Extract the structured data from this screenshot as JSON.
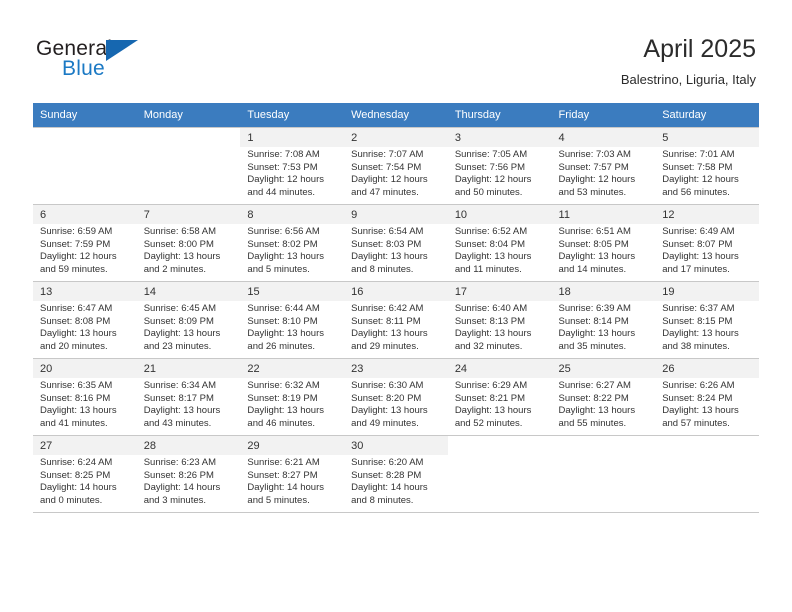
{
  "logo": {
    "word1": "General",
    "word2": "Blue",
    "triangle_color": "#1667b0"
  },
  "header": {
    "title": "April 2025",
    "subtitle": "Balestrino, Liguria, Italy"
  },
  "theme": {
    "header_bg": "#3b7cbf",
    "daynum_band": "#f2f2f2",
    "grid_line": "#c8c8c8"
  },
  "weekdays": [
    "Sunday",
    "Monday",
    "Tuesday",
    "Wednesday",
    "Thursday",
    "Friday",
    "Saturday"
  ],
  "weeks": [
    [
      {
        "day": "",
        "sunrise": "",
        "sunset": "",
        "daylight1": "",
        "daylight2": ""
      },
      {
        "day": "",
        "sunrise": "",
        "sunset": "",
        "daylight1": "",
        "daylight2": ""
      },
      {
        "day": "1",
        "sunrise": "Sunrise: 7:08 AM",
        "sunset": "Sunset: 7:53 PM",
        "daylight1": "Daylight: 12 hours",
        "daylight2": "and 44 minutes."
      },
      {
        "day": "2",
        "sunrise": "Sunrise: 7:07 AM",
        "sunset": "Sunset: 7:54 PM",
        "daylight1": "Daylight: 12 hours",
        "daylight2": "and 47 minutes."
      },
      {
        "day": "3",
        "sunrise": "Sunrise: 7:05 AM",
        "sunset": "Sunset: 7:56 PM",
        "daylight1": "Daylight: 12 hours",
        "daylight2": "and 50 minutes."
      },
      {
        "day": "4",
        "sunrise": "Sunrise: 7:03 AM",
        "sunset": "Sunset: 7:57 PM",
        "daylight1": "Daylight: 12 hours",
        "daylight2": "and 53 minutes."
      },
      {
        "day": "5",
        "sunrise": "Sunrise: 7:01 AM",
        "sunset": "Sunset: 7:58 PM",
        "daylight1": "Daylight: 12 hours",
        "daylight2": "and 56 minutes."
      }
    ],
    [
      {
        "day": "6",
        "sunrise": "Sunrise: 6:59 AM",
        "sunset": "Sunset: 7:59 PM",
        "daylight1": "Daylight: 12 hours",
        "daylight2": "and 59 minutes."
      },
      {
        "day": "7",
        "sunrise": "Sunrise: 6:58 AM",
        "sunset": "Sunset: 8:00 PM",
        "daylight1": "Daylight: 13 hours",
        "daylight2": "and 2 minutes."
      },
      {
        "day": "8",
        "sunrise": "Sunrise: 6:56 AM",
        "sunset": "Sunset: 8:02 PM",
        "daylight1": "Daylight: 13 hours",
        "daylight2": "and 5 minutes."
      },
      {
        "day": "9",
        "sunrise": "Sunrise: 6:54 AM",
        "sunset": "Sunset: 8:03 PM",
        "daylight1": "Daylight: 13 hours",
        "daylight2": "and 8 minutes."
      },
      {
        "day": "10",
        "sunrise": "Sunrise: 6:52 AM",
        "sunset": "Sunset: 8:04 PM",
        "daylight1": "Daylight: 13 hours",
        "daylight2": "and 11 minutes."
      },
      {
        "day": "11",
        "sunrise": "Sunrise: 6:51 AM",
        "sunset": "Sunset: 8:05 PM",
        "daylight1": "Daylight: 13 hours",
        "daylight2": "and 14 minutes."
      },
      {
        "day": "12",
        "sunrise": "Sunrise: 6:49 AM",
        "sunset": "Sunset: 8:07 PM",
        "daylight1": "Daylight: 13 hours",
        "daylight2": "and 17 minutes."
      }
    ],
    [
      {
        "day": "13",
        "sunrise": "Sunrise: 6:47 AM",
        "sunset": "Sunset: 8:08 PM",
        "daylight1": "Daylight: 13 hours",
        "daylight2": "and 20 minutes."
      },
      {
        "day": "14",
        "sunrise": "Sunrise: 6:45 AM",
        "sunset": "Sunset: 8:09 PM",
        "daylight1": "Daylight: 13 hours",
        "daylight2": "and 23 minutes."
      },
      {
        "day": "15",
        "sunrise": "Sunrise: 6:44 AM",
        "sunset": "Sunset: 8:10 PM",
        "daylight1": "Daylight: 13 hours",
        "daylight2": "and 26 minutes."
      },
      {
        "day": "16",
        "sunrise": "Sunrise: 6:42 AM",
        "sunset": "Sunset: 8:11 PM",
        "daylight1": "Daylight: 13 hours",
        "daylight2": "and 29 minutes."
      },
      {
        "day": "17",
        "sunrise": "Sunrise: 6:40 AM",
        "sunset": "Sunset: 8:13 PM",
        "daylight1": "Daylight: 13 hours",
        "daylight2": "and 32 minutes."
      },
      {
        "day": "18",
        "sunrise": "Sunrise: 6:39 AM",
        "sunset": "Sunset: 8:14 PM",
        "daylight1": "Daylight: 13 hours",
        "daylight2": "and 35 minutes."
      },
      {
        "day": "19",
        "sunrise": "Sunrise: 6:37 AM",
        "sunset": "Sunset: 8:15 PM",
        "daylight1": "Daylight: 13 hours",
        "daylight2": "and 38 minutes."
      }
    ],
    [
      {
        "day": "20",
        "sunrise": "Sunrise: 6:35 AM",
        "sunset": "Sunset: 8:16 PM",
        "daylight1": "Daylight: 13 hours",
        "daylight2": "and 41 minutes."
      },
      {
        "day": "21",
        "sunrise": "Sunrise: 6:34 AM",
        "sunset": "Sunset: 8:17 PM",
        "daylight1": "Daylight: 13 hours",
        "daylight2": "and 43 minutes."
      },
      {
        "day": "22",
        "sunrise": "Sunrise: 6:32 AM",
        "sunset": "Sunset: 8:19 PM",
        "daylight1": "Daylight: 13 hours",
        "daylight2": "and 46 minutes."
      },
      {
        "day": "23",
        "sunrise": "Sunrise: 6:30 AM",
        "sunset": "Sunset: 8:20 PM",
        "daylight1": "Daylight: 13 hours",
        "daylight2": "and 49 minutes."
      },
      {
        "day": "24",
        "sunrise": "Sunrise: 6:29 AM",
        "sunset": "Sunset: 8:21 PM",
        "daylight1": "Daylight: 13 hours",
        "daylight2": "and 52 minutes."
      },
      {
        "day": "25",
        "sunrise": "Sunrise: 6:27 AM",
        "sunset": "Sunset: 8:22 PM",
        "daylight1": "Daylight: 13 hours",
        "daylight2": "and 55 minutes."
      },
      {
        "day": "26",
        "sunrise": "Sunrise: 6:26 AM",
        "sunset": "Sunset: 8:24 PM",
        "daylight1": "Daylight: 13 hours",
        "daylight2": "and 57 minutes."
      }
    ],
    [
      {
        "day": "27",
        "sunrise": "Sunrise: 6:24 AM",
        "sunset": "Sunset: 8:25 PM",
        "daylight1": "Daylight: 14 hours",
        "daylight2": "and 0 minutes."
      },
      {
        "day": "28",
        "sunrise": "Sunrise: 6:23 AM",
        "sunset": "Sunset: 8:26 PM",
        "daylight1": "Daylight: 14 hours",
        "daylight2": "and 3 minutes."
      },
      {
        "day": "29",
        "sunrise": "Sunrise: 6:21 AM",
        "sunset": "Sunset: 8:27 PM",
        "daylight1": "Daylight: 14 hours",
        "daylight2": "and 5 minutes."
      },
      {
        "day": "30",
        "sunrise": "Sunrise: 6:20 AM",
        "sunset": "Sunset: 8:28 PM",
        "daylight1": "Daylight: 14 hours",
        "daylight2": "and 8 minutes."
      },
      {
        "day": "",
        "sunrise": "",
        "sunset": "",
        "daylight1": "",
        "daylight2": ""
      },
      {
        "day": "",
        "sunrise": "",
        "sunset": "",
        "daylight1": "",
        "daylight2": ""
      },
      {
        "day": "",
        "sunrise": "",
        "sunset": "",
        "daylight1": "",
        "daylight2": ""
      }
    ]
  ]
}
